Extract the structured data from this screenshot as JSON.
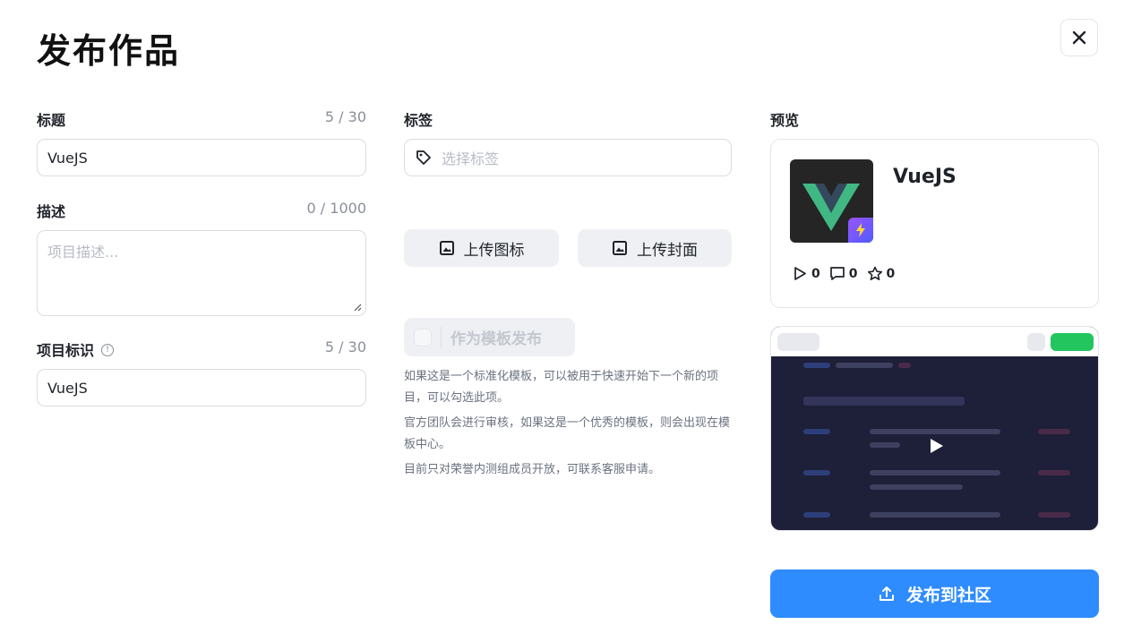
{
  "dialog": {
    "title": "发布作品",
    "close_icon": "close-icon"
  },
  "form": {
    "title": {
      "label": "标题",
      "counter": "5 / 30",
      "value": "VueJS"
    },
    "description": {
      "label": "描述",
      "counter": "0 / 1000",
      "placeholder": "项目描述..."
    },
    "identifier": {
      "label": "项目标识",
      "counter": "5 / 30",
      "value": "VueJS"
    },
    "tags": {
      "label": "标签",
      "placeholder": "选择标签"
    }
  },
  "uploads": {
    "icon_label": "上传图标",
    "cover_label": "上传封面"
  },
  "template": {
    "label": "作为模板发布",
    "help": [
      "如果这是一个标准化模板，可以被用于快速开始下一个新的项目，可以勾选此项。",
      "官方团队会进行审核，如果这是一个优秀的模板，则会出现在模板中心。",
      "目前只对荣誉内测组成员开放，可联系客服申请。"
    ]
  },
  "preview": {
    "label": "预览",
    "name": "VueJS",
    "stats": {
      "plays": "0",
      "comments": "0",
      "stars": "0"
    }
  },
  "publish": {
    "label": "发布到社区"
  },
  "colors": {
    "primary": "#2f8cff",
    "vue_green": "#41b883",
    "vue_dark": "#34495e"
  }
}
